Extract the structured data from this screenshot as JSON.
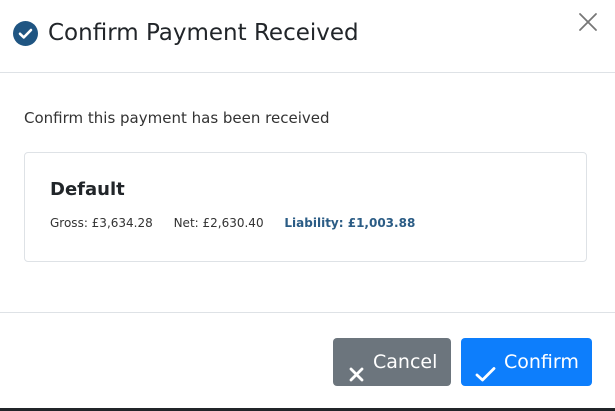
{
  "dialog": {
    "title": "Confirm Payment Received",
    "title_icon": "check-circle-icon",
    "close_icon": "close-icon",
    "body_text": "Confirm this payment has been received"
  },
  "payment": {
    "name": "Default",
    "gross": "Gross: £3,634.28",
    "net": "Net: £2,630.40",
    "liability": "Liability: £1,003.88"
  },
  "footer": {
    "cancel_label": "Cancel",
    "cancel_icon": "x-icon",
    "confirm_label": "Confirm",
    "confirm_icon": "checkmark-icon"
  },
  "colors": {
    "title_icon": "#1f5582",
    "liability_text": "#2b5c85",
    "cancel_button": "#6c757d",
    "confirm_button": "#0d7efc"
  }
}
